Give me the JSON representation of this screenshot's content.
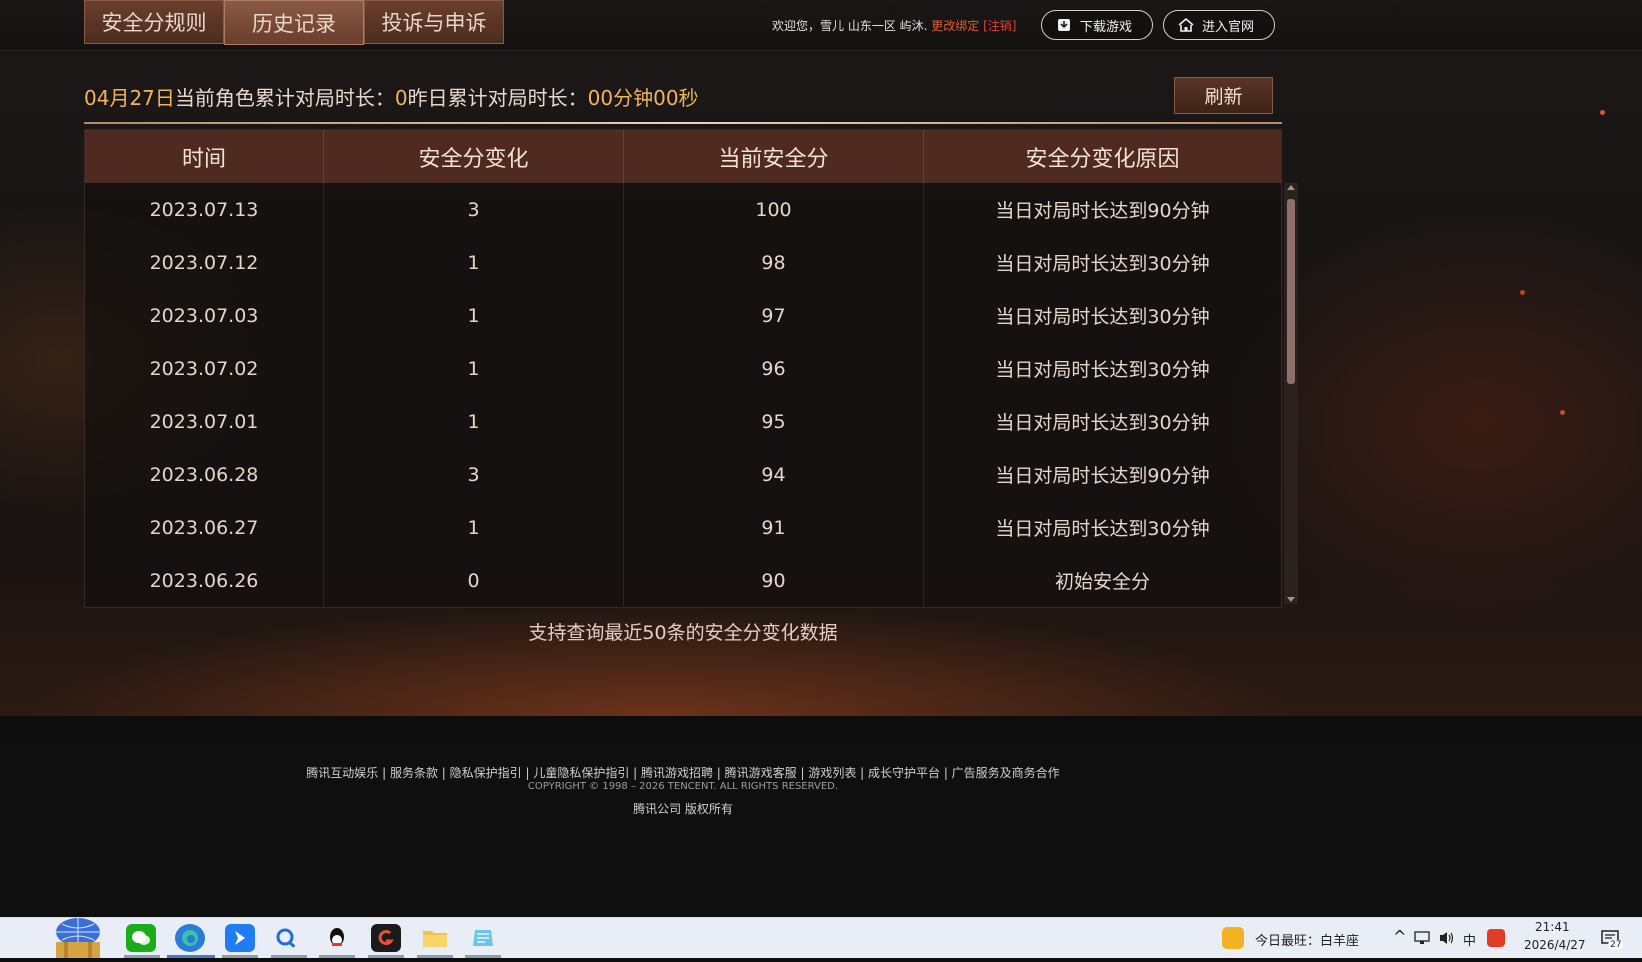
{
  "nav": {
    "tabs": [
      {
        "label": "安全分规则"
      },
      {
        "label": "历史记录"
      },
      {
        "label": "投诉与申诉"
      }
    ]
  },
  "user": {
    "welcome_text": "欢迎您，雪儿 山东一区 屿沐.",
    "change_bind": "更改绑定",
    "logout": "[注销]"
  },
  "header_buttons": {
    "download": "下载游戏",
    "official": "进入官网"
  },
  "summary": {
    "date": "04月27日",
    "current_label": "当前角色累计对局时长：",
    "current_value": "0",
    "yesterday_label": "昨日累计对局时长：",
    "yesterday_value": "00分钟00秒"
  },
  "refresh_label": "刷新",
  "table": {
    "headers": [
      "时间",
      "安全分变化",
      "当前安全分",
      "安全分变化原因"
    ],
    "rows": [
      [
        "2023.07.13",
        "3",
        "100",
        "当日对局时长达到90分钟"
      ],
      [
        "2023.07.12",
        "1",
        "98",
        "当日对局时长达到30分钟"
      ],
      [
        "2023.07.03",
        "1",
        "97",
        "当日对局时长达到30分钟"
      ],
      [
        "2023.07.02",
        "1",
        "96",
        "当日对局时长达到30分钟"
      ],
      [
        "2023.07.01",
        "1",
        "95",
        "当日对局时长达到30分钟"
      ],
      [
        "2023.06.28",
        "3",
        "94",
        "当日对局时长达到90分钟"
      ],
      [
        "2023.06.27",
        "1",
        "91",
        "当日对局时长达到30分钟"
      ],
      [
        "2023.06.26",
        "0",
        "90",
        "初始安全分"
      ]
    ]
  },
  "note": "支持查询最近50条的安全分变化数据",
  "footer": {
    "links": "腾讯互动娱乐 | 服务条款 | 隐私保护指引 | 儿童隐私保护指引 | 腾讯游戏招聘 | 腾讯游戏客服 | 游戏列表 | 成长守护平台 | 广告服务及商务合作",
    "copyright": "COPYRIGHT © 1998 – 2026 TENCENT. ALL RIGHTS RESERVED.",
    "company": "腾讯公司 版权所有"
  },
  "taskbar": {
    "weather_text": "今日最旺：白羊座",
    "ime": "中",
    "time": "21:41",
    "date": "2026/4/27",
    "notification_count": "27",
    "icons": [
      "start-icon",
      "wechat-icon",
      "edge-icon",
      "arrow-app-icon",
      "search-app-icon",
      "qq-icon",
      "game-icon",
      "folder-icon",
      "notes-icon"
    ]
  }
}
